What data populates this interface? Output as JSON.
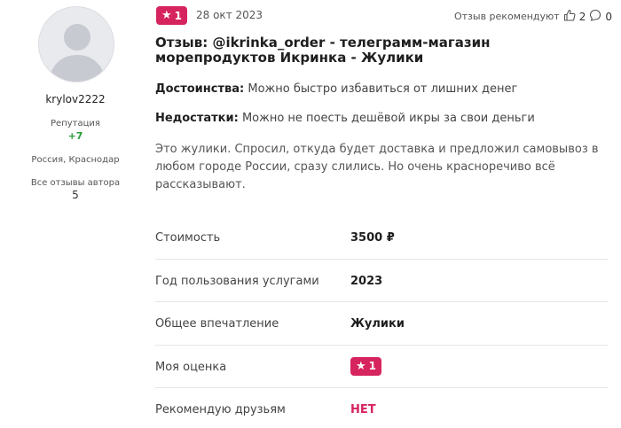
{
  "author": {
    "name": "krylov2222",
    "reputation_label": "Репутация",
    "reputation_value": "+7",
    "location": "Россия, Краснодар",
    "all_reviews_label": "Все отзывы автора",
    "all_reviews_count": "5",
    "avatar_icon": "default-user-icon"
  },
  "review": {
    "rating": "1",
    "date": "28 окт 2023",
    "recommend_label": "Отзыв рекомендуют",
    "likes": "2",
    "comments": "0",
    "title": "Отзыв: @ikrinka_order - телеграмм-магазин морепродуктов Икринка - Жулики",
    "pros_label": "Достоинства:",
    "pros_text": " Можно быстро избавиться от лишних денег",
    "cons_label": "Недостатки:",
    "cons_text": " Можно не поесть дешёвой икры за свои деньги",
    "body": "Это жулики. Спросил, откуда будет доставка и предложил самовывоз в любом городе России, сразу слились. Но очень красноречиво всё рассказывают."
  },
  "facts": {
    "cost_label": "Стоимость",
    "cost_value": "3500 ₽",
    "year_label": "Год пользования услугами",
    "year_value": "2023",
    "impression_label": "Общее впечатление",
    "impression_value": "Жулики",
    "my_rating_label": "Моя оценка",
    "my_rating_value": "1",
    "recommend_label": "Рекомендую друзьям",
    "recommend_value": "НЕТ"
  },
  "colors": {
    "accent": "#d6245e",
    "reputation": "#2a9d3a"
  }
}
